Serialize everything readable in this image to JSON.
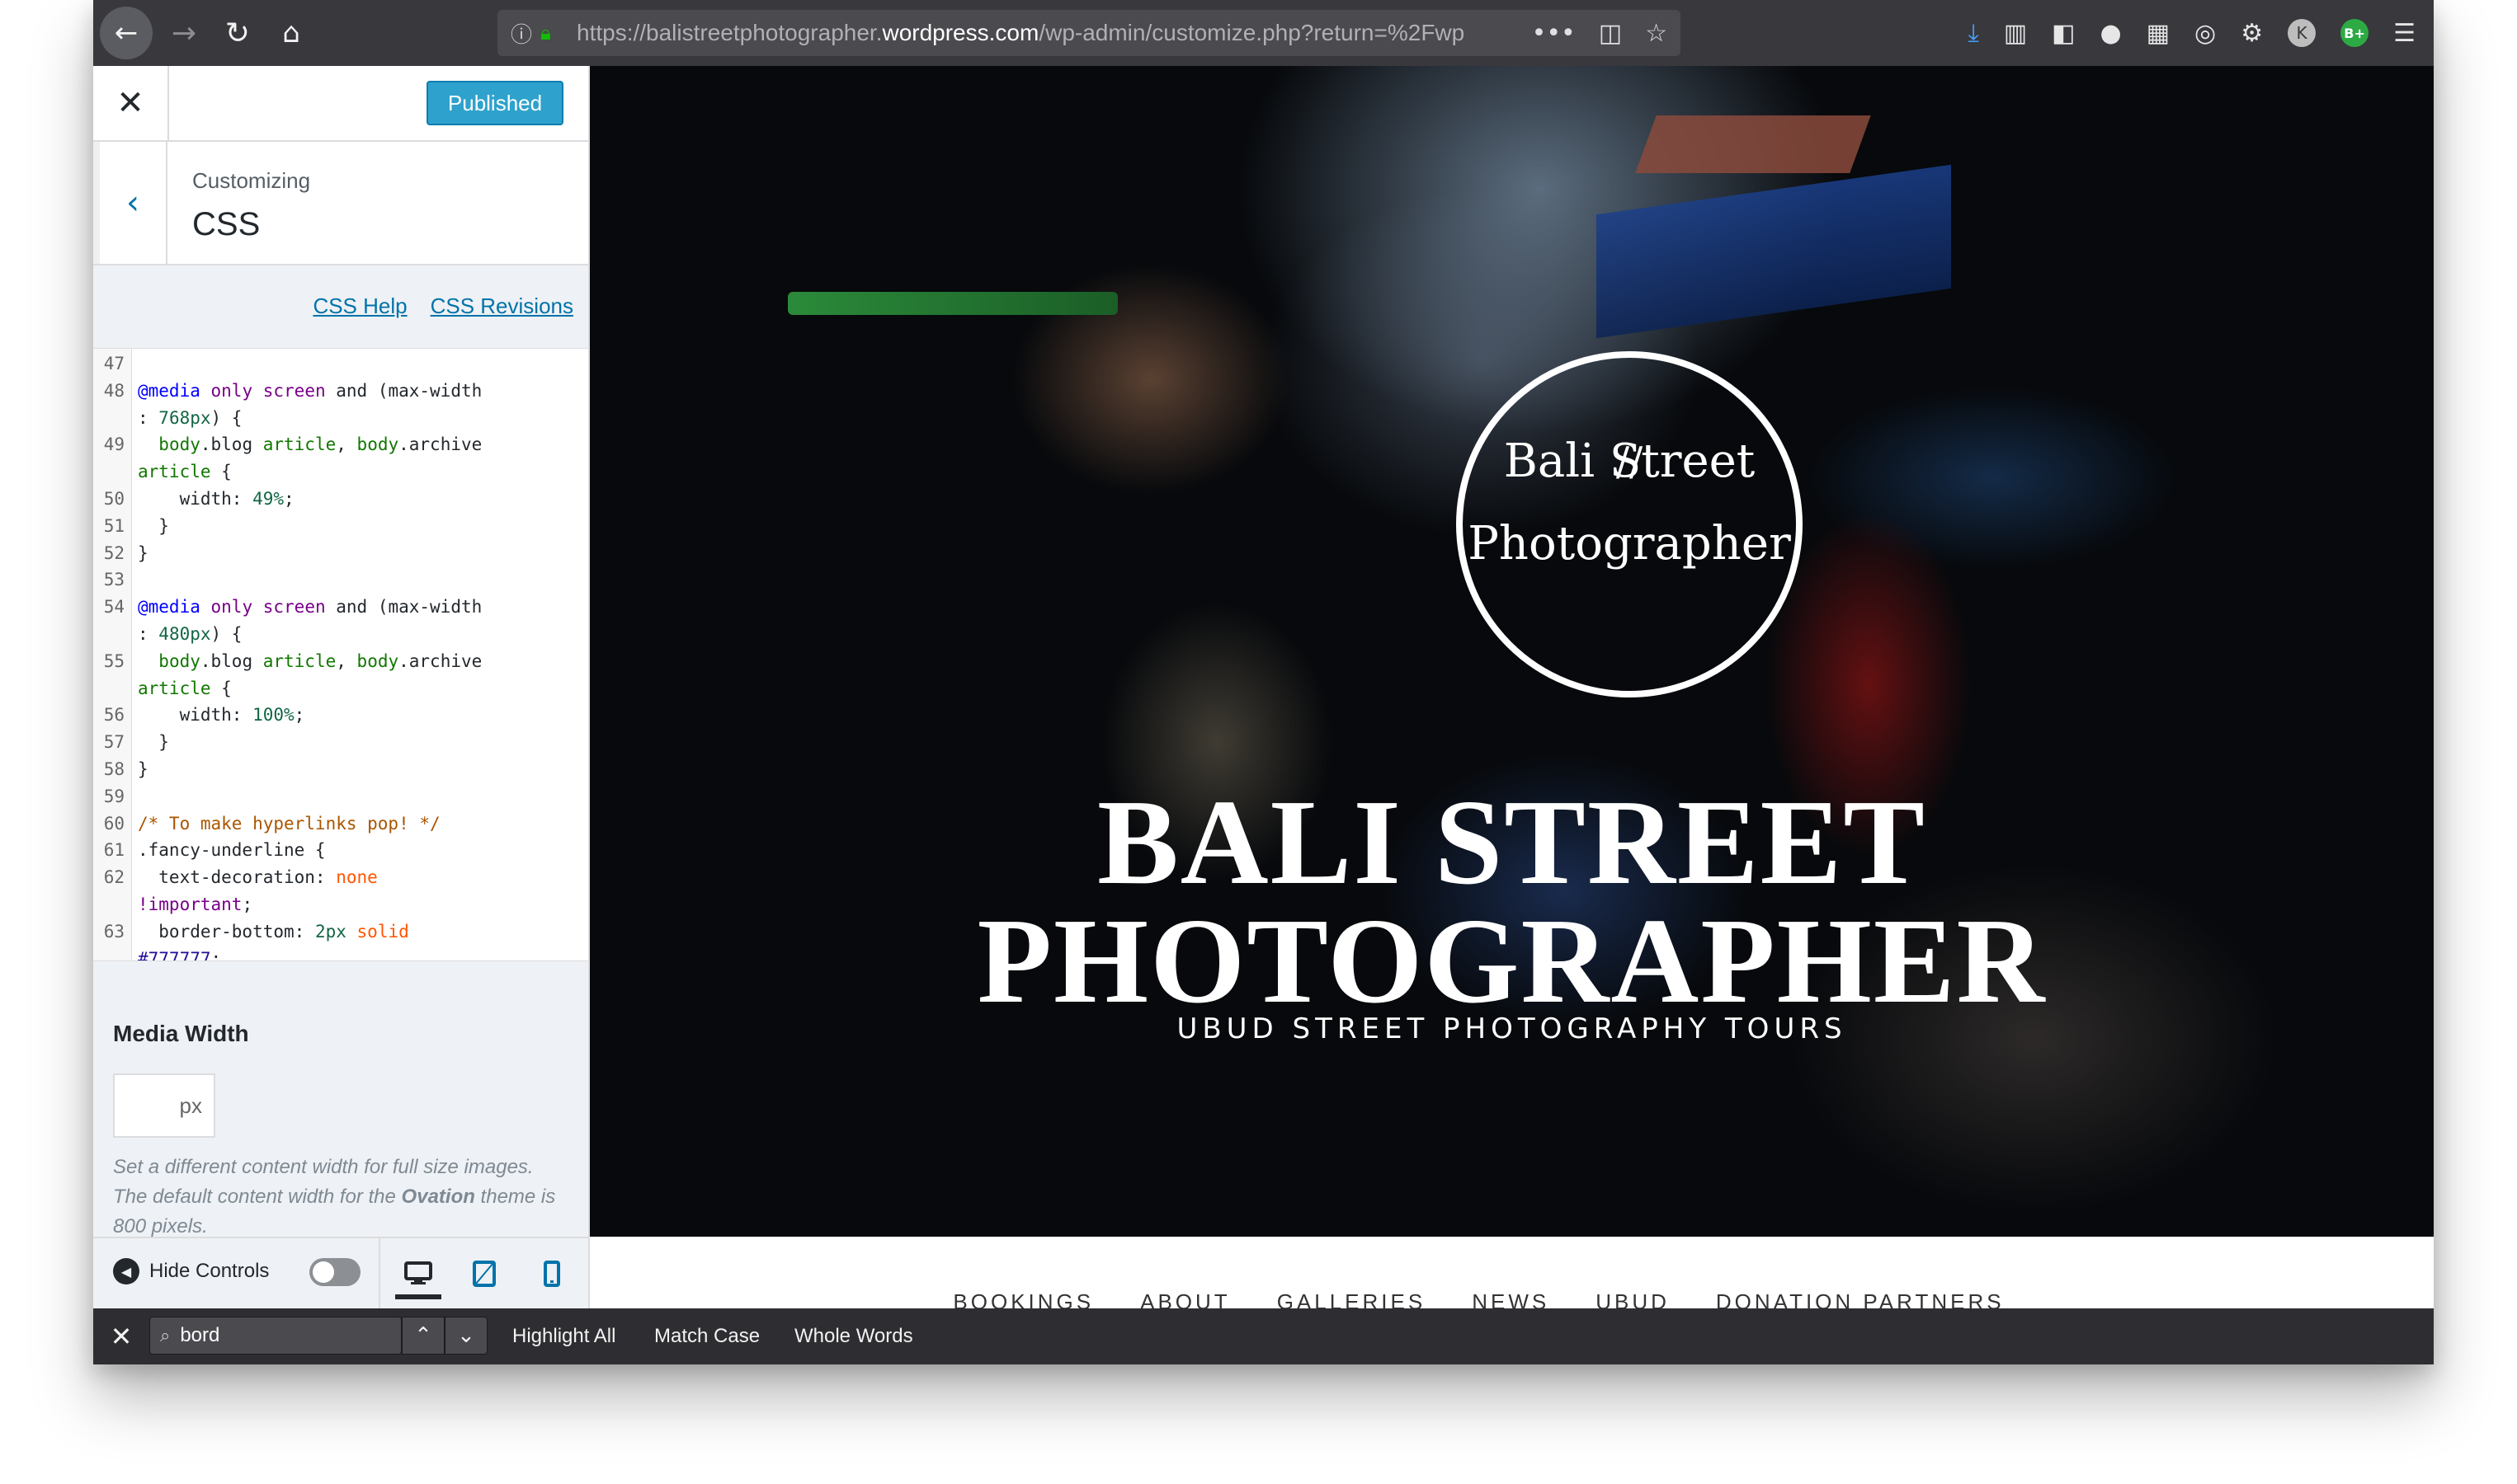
{
  "browser": {
    "url_prefix": "https://balistreetphotographer.",
    "url_domain": "wordpress.com",
    "url_suffix": "/wp-admin/customize.php?return=%2Fwp",
    "icons": {
      "back": "back-arrow-icon",
      "forward": "forward-arrow-icon",
      "reload": "reload-icon",
      "home": "home-icon",
      "info": "info-icon",
      "lock": "lock-icon",
      "page_actions": "ellipsis-icon",
      "pocket": "pocket-icon",
      "bookmark": "star-icon",
      "downloads": "download-icon",
      "library": "library-icon",
      "sidebar": "sidebar-icon",
      "extensions": [
        "ext-dark-icon",
        "ext-grey-icon",
        "ext-translate-icon",
        "ext-gear-icon"
      ],
      "ext_k_label": "K",
      "ext_b_label": "B+",
      "menu": "hamburger-icon"
    }
  },
  "customizer": {
    "close_icon": "close-icon",
    "publish_label": "Published",
    "panel_subtitle": "Customizing",
    "panel_title": "CSS",
    "help_link": "CSS Help",
    "revisions_link": "CSS Revisions",
    "code_lines": [
      {
        "n": "47",
        "html": ""
      },
      {
        "n": "48",
        "html": "<span class=\"cm-def\">@media</span> <span class=\"cm-kw\">only</span> <span class=\"cm-kw\">screen</span> and (max-width"
      },
      {
        "n": "",
        "html": ": <span class=\"cm-num\">768px</span>) {"
      },
      {
        "n": "49",
        "html": "  <span class=\"cm-tag\">body</span>.blog <span class=\"cm-tag\">article</span>, <span class=\"cm-tag\">body</span>.archive"
      },
      {
        "n": "",
        "html": "<span class=\"cm-tag\">article</span> {"
      },
      {
        "n": "50",
        "html": "    width: <span class=\"cm-num\">49%</span>;"
      },
      {
        "n": "51",
        "html": "  }"
      },
      {
        "n": "52",
        "html": "}"
      },
      {
        "n": "53",
        "html": ""
      },
      {
        "n": "54",
        "html": "<span class=\"cm-def\">@media</span> <span class=\"cm-kw\">only</span> <span class=\"cm-kw\">screen</span> and (max-width"
      },
      {
        "n": "",
        "html": ": <span class=\"cm-num\">480px</span>) {"
      },
      {
        "n": "55",
        "html": "  <span class=\"cm-tag\">body</span>.blog <span class=\"cm-tag\">article</span>, <span class=\"cm-tag\">body</span>.archive"
      },
      {
        "n": "",
        "html": "<span class=\"cm-tag\">article</span> {"
      },
      {
        "n": "56",
        "html": "    width: <span class=\"cm-num\">100%</span>;"
      },
      {
        "n": "57",
        "html": "  }"
      },
      {
        "n": "58",
        "html": "}"
      },
      {
        "n": "59",
        "html": ""
      },
      {
        "n": "60",
        "html": "<span class=\"cm-com\">/* To make hyperlinks pop! */</span>"
      },
      {
        "n": "61",
        "html": ".fancy-underline {"
      },
      {
        "n": "62",
        "html": "  text-decoration: <span class=\"cm-atom\">none</span>"
      },
      {
        "n": "",
        "html": "<span class=\"cm-key\">!important</span>;"
      },
      {
        "n": "63",
        "html": "  border-bottom: <span class=\"cm-num\">2px</span> <span class=\"cm-atom\">solid</span>"
      },
      {
        "n": "",
        "html": "<span class=\"cm-hex\">#777777</span>;"
      }
    ],
    "media_width": {
      "title": "Media Width",
      "value": "",
      "unit": "px",
      "description_1": "Set a different content width for full size images. The default content width for the ",
      "description_theme": "Ovation",
      "description_2": " theme is 800 pixels."
    },
    "footer": {
      "hide_controls_label": "Hide Controls",
      "hide_controls_icon": "collapse-arrow-icon",
      "toggle_icon": "toggle-icon",
      "device_icons": [
        "desktop-icon",
        "tablet-icon",
        "mobile-icon"
      ],
      "active_device": "desktop"
    }
  },
  "preview": {
    "logo_line1": "Bali Street",
    "logo_sep": "//",
    "logo_line2": "Photographer",
    "site_title_line1": "BALI STREET",
    "site_title_line2": "PHOTOGRAPHER",
    "tagline": "UBUD STREET PHOTOGRAPHY TOURS",
    "nav": [
      "BOOKINGS",
      "ABOUT",
      "GALLERIES",
      "NEWS",
      "UBUD",
      "DONATION PARTNERS"
    ]
  },
  "findbar": {
    "query": "bord",
    "highlight_all": "Highlight All",
    "match_case": "Match Case",
    "whole_words": "Whole Words",
    "prev_icon": "chevron-up-icon",
    "next_icon": "chevron-down-icon",
    "search_icon": "search-icon",
    "close_icon": "close-icon"
  },
  "colors": {
    "publish_button": "#2ea2cc",
    "link": "#0073aa",
    "toolbar": "#38383d",
    "findbar": "#2e2e32"
  }
}
